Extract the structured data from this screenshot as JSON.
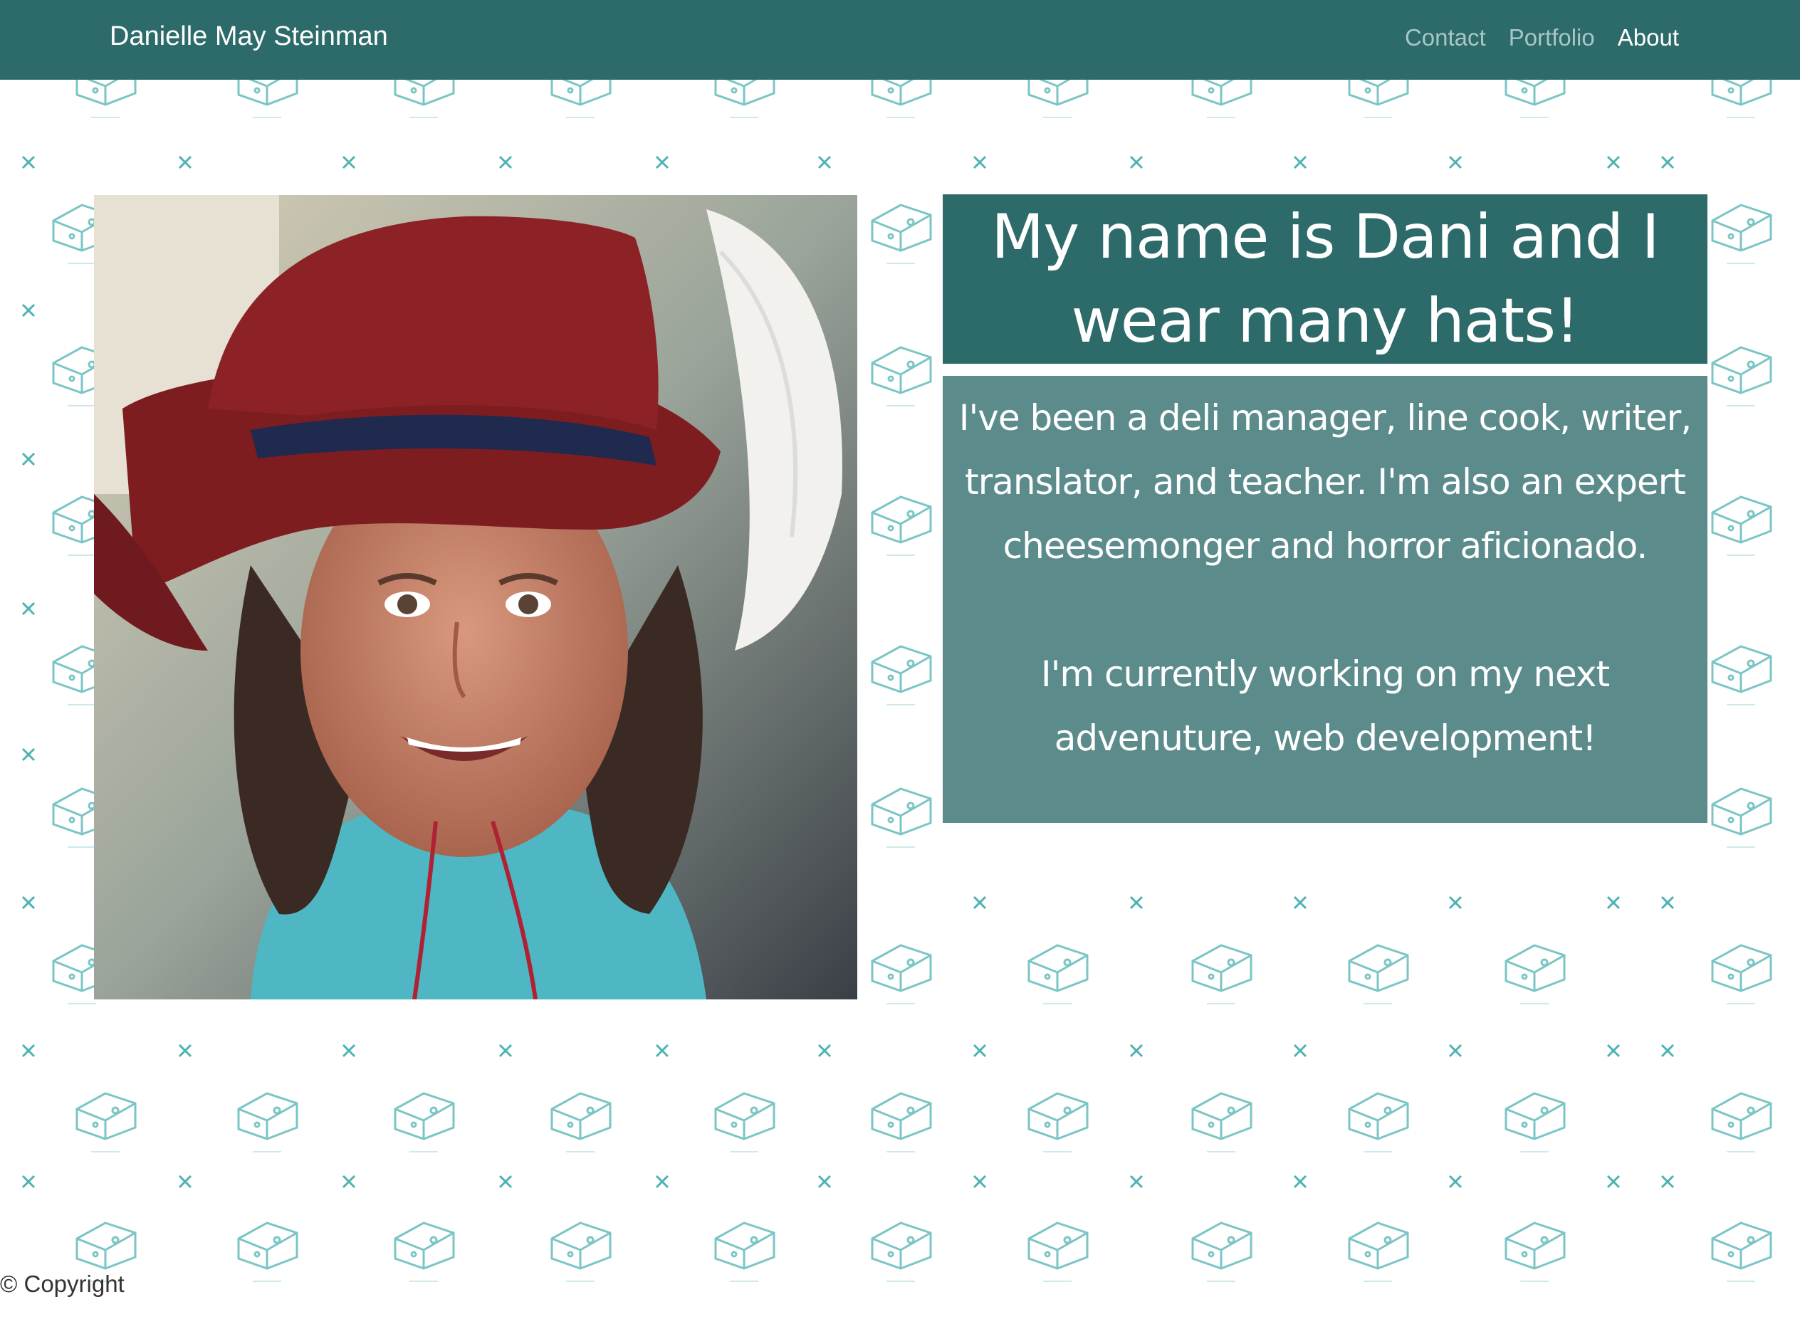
{
  "navbar": {
    "brand": "Danielle May Steinman",
    "links": [
      {
        "label": "Contact",
        "active": false
      },
      {
        "label": "Portfolio",
        "active": false
      },
      {
        "label": "About",
        "active": true
      }
    ]
  },
  "hero": {
    "heading": "My name is Dani and I wear many hats!",
    "bio_paragraph_1": "I've been a deli manager, line cook, writer, translator, and teacher. I'm also an expert cheesemonger and horror aficionado.",
    "bio_paragraph_2": "I'm currently working on my next advenuture, web development!"
  },
  "footer": {
    "copyright": "© Copyright"
  },
  "colors": {
    "navbar": "#2d6a6a",
    "heading_box": "#2d6a6a",
    "bio_box": "#5f8d8c",
    "pattern": "#4fb2b2",
    "text_on_dark": "#ffffff"
  }
}
